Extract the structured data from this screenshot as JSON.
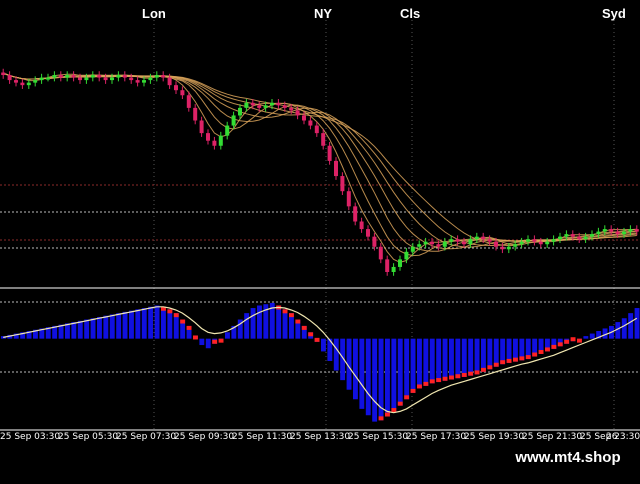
{
  "sessions": [
    {
      "name": "session-lon",
      "label": "Lon"
    },
    {
      "name": "session-ny",
      "label": "NY"
    },
    {
      "name": "session-cls",
      "label": "Cls"
    },
    {
      "name": "session-syd",
      "label": "Syd"
    }
  ],
  "time_axis": [
    "25 Sep 03:30",
    "25 Sep 05:30",
    "25 Sep 07:30",
    "25 Sep 09:30",
    "25 Sep 11:30",
    "25 Sep 13:30",
    "25 Sep 15:30",
    "25 Sep 17:30",
    "25 Sep 19:30",
    "25 Sep 21:30",
    "25 Sep 23:30",
    "26"
  ],
  "watermark": "www.mt4.shop",
  "colors": {
    "background": "#000000",
    "bull_candle": "#33dd33",
    "bear_candle": "#dd2266",
    "ribbon": "#d9a35a",
    "histogram": "#1010e0",
    "histogram_alt": "#ff2222",
    "signal_line": "#f0e6b0",
    "grid": "#555555",
    "level_line": "#8b2a2a"
  },
  "chart_data": [
    {
      "type": "line",
      "panel": "price",
      "note_series": "candle closes (relative price units, higher = higher price)",
      "x_count": 100,
      "series": [
        {
          "values": [
            78,
            76,
            75,
            74,
            75,
            76,
            77,
            77,
            78,
            77,
            78,
            77,
            76,
            77,
            78,
            77,
            76,
            77,
            78,
            77,
            76,
            75,
            76,
            77,
            78,
            77,
            74,
            72,
            70,
            65,
            60,
            55,
            52,
            50,
            54,
            58,
            62,
            65,
            67,
            66,
            65,
            66,
            67,
            66,
            65,
            64,
            62,
            60,
            58,
            55,
            50,
            44,
            38,
            32,
            26,
            20,
            17,
            14,
            10,
            5,
            0,
            2,
            5,
            8,
            10,
            11,
            12,
            11,
            10,
            12,
            13,
            12,
            11,
            13,
            14,
            13,
            12,
            10,
            9,
            10,
            11,
            12,
            13,
            12,
            11,
            12,
            13,
            14,
            15,
            14,
            13,
            14,
            15,
            16,
            17,
            16,
            15,
            16,
            17,
            16
          ]
        }
      ],
      "ylim": [
        0,
        80
      ]
    },
    {
      "type": "bar",
      "panel": "oscillator",
      "x_count": 100,
      "series": [
        {
          "values": [
            4,
            6,
            8,
            10,
            12,
            14,
            16,
            18,
            20,
            22,
            24,
            26,
            28,
            30,
            32,
            34,
            36,
            38,
            40,
            42,
            44,
            46,
            48,
            50,
            52,
            50,
            46,
            40,
            30,
            20,
            5,
            -10,
            -15,
            -8,
            0,
            10,
            20,
            30,
            40,
            48,
            52,
            54,
            56,
            52,
            46,
            40,
            30,
            20,
            10,
            -5,
            -20,
            -35,
            -50,
            -65,
            -80,
            -95,
            -110,
            -120,
            -130,
            -128,
            -122,
            -115,
            -105,
            -95,
            -85,
            -78,
            -74,
            -70,
            -68,
            -66,
            -64,
            -62,
            -60,
            -58,
            -56,
            -52,
            -48,
            -44,
            -40,
            -38,
            -36,
            -34,
            -32,
            -28,
            -24,
            -20,
            -16,
            -12,
            -8,
            -4,
            0,
            4,
            8,
            12,
            16,
            20,
            26,
            32,
            40,
            48
          ]
        },
        {
          "values": [
            2,
            4,
            6,
            8,
            10,
            12,
            14,
            16,
            18,
            20,
            22,
            24,
            26,
            28,
            30,
            32,
            34,
            36,
            38,
            40,
            42,
            44,
            46,
            48,
            50,
            50,
            48,
            45,
            40,
            33,
            25,
            16,
            10,
            8,
            9,
            12,
            17,
            23,
            30,
            36,
            41,
            45,
            48,
            49,
            48,
            45,
            41,
            35,
            28,
            20,
            10,
            -2,
            -15,
            -29,
            -44,
            -58,
            -72,
            -86,
            -98,
            -108,
            -114,
            -116,
            -114,
            -110,
            -104,
            -98,
            -92,
            -86,
            -81,
            -77,
            -73,
            -70,
            -67,
            -64,
            -61,
            -58,
            -55,
            -52,
            -49,
            -46,
            -43,
            -40,
            -38,
            -35,
            -32,
            -29,
            -26,
            -22,
            -18,
            -14,
            -10,
            -6,
            -2,
            2,
            6,
            10,
            15,
            20,
            26,
            32
          ]
        }
      ],
      "ylim": [
        -140,
        70
      ]
    }
  ]
}
